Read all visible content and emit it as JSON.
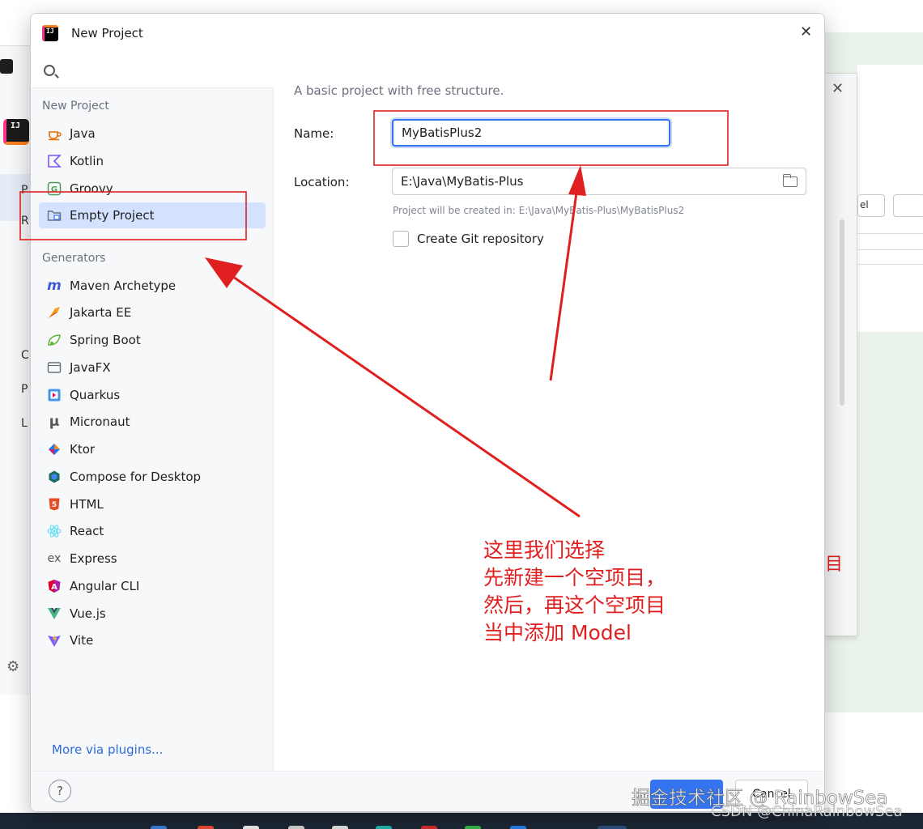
{
  "dialog": {
    "title": "New Project",
    "search": {
      "placeholder": "",
      "value": ""
    },
    "sections": {
      "new_project": "New Project",
      "generators": "Generators"
    },
    "new_project_items": [
      {
        "label": "Java",
        "icon": "java-cup-icon"
      },
      {
        "label": "Kotlin",
        "icon": "kotlin-icon"
      },
      {
        "label": "Groovy",
        "icon": "groovy-icon"
      },
      {
        "label": "Empty Project",
        "icon": "folder-icon"
      }
    ],
    "generator_items": [
      {
        "label": "Maven Archetype",
        "icon": "maven-icon"
      },
      {
        "label": "Jakarta EE",
        "icon": "jakarta-ee-icon"
      },
      {
        "label": "Spring Boot",
        "icon": "spring-boot-icon"
      },
      {
        "label": "JavaFX",
        "icon": "javafx-icon"
      },
      {
        "label": "Quarkus",
        "icon": "quarkus-icon"
      },
      {
        "label": "Micronaut",
        "icon": "micronaut-icon"
      },
      {
        "label": "Ktor",
        "icon": "ktor-icon"
      },
      {
        "label": "Compose for Desktop",
        "icon": "compose-icon"
      },
      {
        "label": "HTML",
        "icon": "html5-icon"
      },
      {
        "label": "React",
        "icon": "react-icon"
      },
      {
        "label": "Express",
        "icon": "express-icon"
      },
      {
        "label": "Angular CLI",
        "icon": "angular-icon"
      },
      {
        "label": "Vue.js",
        "icon": "vue-icon"
      },
      {
        "label": "Vite",
        "icon": "vite-icon"
      }
    ],
    "selected_item": "Empty Project",
    "more_plugins": "More via plugins...",
    "form": {
      "description": "A basic project with free structure.",
      "name_label": "Name:",
      "name_value": "MyBatisPlus2",
      "location_label": "Location:",
      "location_value": "E:\\Java\\MyBatis-Plus",
      "created_hint": "Project will be created in: E:\\Java\\MyBatis-Plus\\MyBatisPlus2",
      "git_label": "Create Git repository",
      "git_checked": false
    },
    "buttons": {
      "help": "?",
      "create": "",
      "cancel": "Cancel"
    }
  },
  "annotation": {
    "lines": [
      "这里我们选择",
      "先新建一个空项目，",
      "然后，再这个空项目",
      "当中添加 Model"
    ],
    "color": "#e02020"
  },
  "watermark": {
    "line1": "掘金技术社区 @ RainbowSea",
    "line2": "CSDN @ChinaRainbowSea"
  },
  "colors": {
    "accent": "#3574f0",
    "selection": "#d4e2ff",
    "annotation_red": "#e02020"
  }
}
